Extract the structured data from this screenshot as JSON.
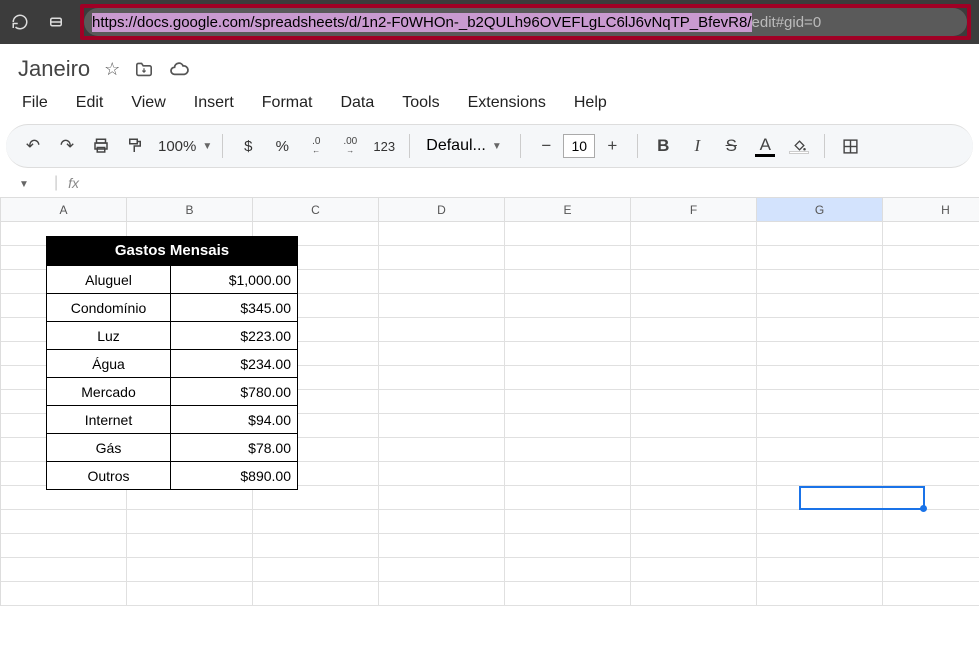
{
  "browser": {
    "url_highlighted": "https://docs.google.com/spreadsheets/d/1n2-F0WHOn-_b2QULh96OVEFLgLC6lJ6vNqTP_BfevR8/",
    "url_rest": "edit#gid=0"
  },
  "doc": {
    "title": "Janeiro"
  },
  "menubar": {
    "file": "File",
    "edit": "Edit",
    "view": "View",
    "insert": "Insert",
    "format": "Format",
    "data": "Data",
    "tools": "Tools",
    "extensions": "Extensions",
    "help": "Help"
  },
  "toolbar": {
    "zoom": "100%",
    "currency": "$",
    "percent": "%",
    "dec_less": ".0",
    "dec_more": ".00",
    "number_123": "123",
    "font": "Defaul...",
    "minus": "−",
    "fontsize": "10",
    "plus": "+",
    "bold": "B",
    "italic": "I",
    "strike": "S",
    "textcolor": "A"
  },
  "fx": {
    "label": "fx"
  },
  "columns": [
    "A",
    "B",
    "C",
    "D",
    "E",
    "F",
    "G",
    "H"
  ],
  "active_col_index": 6,
  "table": {
    "header": "Gastos Mensais",
    "rows": [
      {
        "label": "Aluguel",
        "value": "$1,000.00"
      },
      {
        "label": "Condomínio",
        "value": "$345.00"
      },
      {
        "label": "Luz",
        "value": "$223.00"
      },
      {
        "label": "Água",
        "value": "$234.00"
      },
      {
        "label": "Mercado",
        "value": "$780.00"
      },
      {
        "label": "Internet",
        "value": "$94.00"
      },
      {
        "label": "Gás",
        "value": "$78.00"
      },
      {
        "label": "Outros",
        "value": "$890.00"
      }
    ]
  }
}
